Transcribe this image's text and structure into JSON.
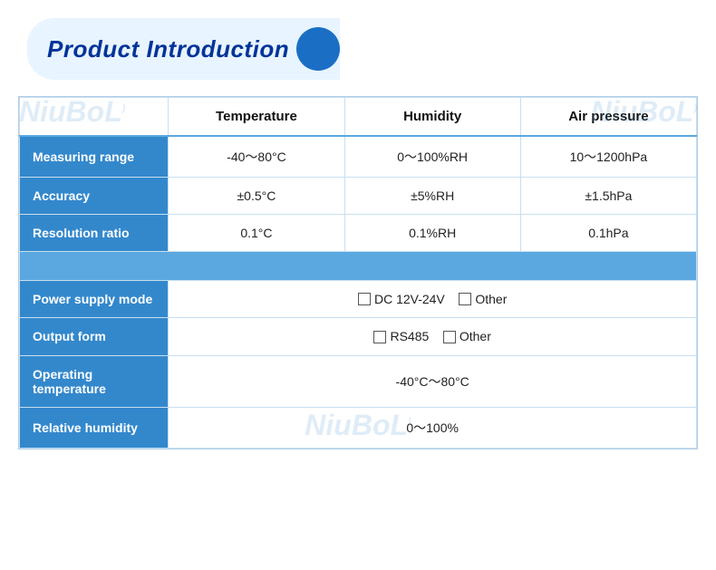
{
  "title": {
    "text": "Product Introduction"
  },
  "watermark": "NiuBoL",
  "table": {
    "headers": {
      "col0": "",
      "col1": "Temperature",
      "col2": "Humidity",
      "col3": "Air pressure"
    },
    "rows": [
      {
        "label": "Measuring range",
        "temp": "-40～80°C",
        "hum": "0～100%RH",
        "air": "10～1200hPa"
      },
      {
        "label": "Accuracy",
        "temp": "±0.5°C",
        "hum": "±5%RH",
        "air": "±1.5hPa"
      },
      {
        "label": "Resolution ratio",
        "temp": "0.1°C",
        "hum": "0.1%RH",
        "air": "0.1hPa"
      }
    ],
    "bottom_rows": [
      {
        "label": "Power supply mode",
        "value": "DC 12V-24V",
        "extra": "Other"
      },
      {
        "label": "Output form",
        "value": "RS485",
        "extra": "Other"
      },
      {
        "label": "Operating temperature",
        "value": "-40°C～80°C",
        "extra": ""
      },
      {
        "label": "Relative humidity",
        "value": "0～100%",
        "extra": ""
      }
    ]
  }
}
